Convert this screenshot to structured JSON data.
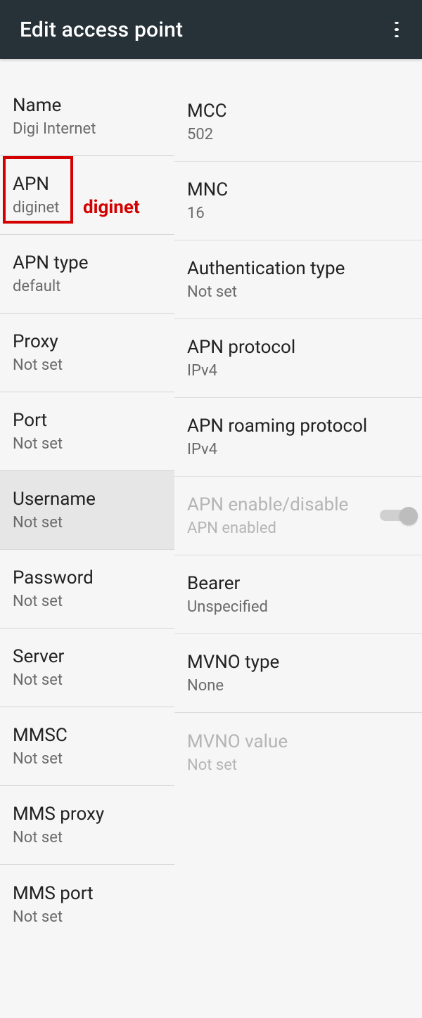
{
  "header": {
    "title": "Edit access point"
  },
  "left": [
    {
      "label": "Name",
      "value": "Digi Internet"
    },
    {
      "label": "APN",
      "value": "diginet",
      "highlighted": true
    },
    {
      "label": "APN type",
      "value": "default"
    },
    {
      "label": "Proxy",
      "value": "Not set"
    },
    {
      "label": "Port",
      "value": "Not set"
    },
    {
      "label": "Username",
      "value": "Not set",
      "selected": true
    },
    {
      "label": "Password",
      "value": "Not set"
    },
    {
      "label": "Server",
      "value": "Not set"
    },
    {
      "label": "MMSC",
      "value": "Not set"
    },
    {
      "label": "MMS proxy",
      "value": "Not set"
    },
    {
      "label": "MMS port",
      "value": "Not set"
    }
  ],
  "right": [
    {
      "label": "MCC",
      "value": "502"
    },
    {
      "label": "MNC",
      "value": "16"
    },
    {
      "label": "Authentication type",
      "value": "Not set"
    },
    {
      "label": "APN protocol",
      "value": "IPv4"
    },
    {
      "label": "APN roaming protocol",
      "value": "IPv4"
    },
    {
      "label": "APN enable/disable",
      "value": "APN enabled",
      "disabled": true,
      "toggle": true
    },
    {
      "label": "Bearer",
      "value": "Unspecified"
    },
    {
      "label": "MVNO type",
      "value": "None"
    },
    {
      "label": "MVNO value",
      "value": "Not set",
      "disabled": true
    }
  ],
  "annotation": {
    "text": "diginet"
  }
}
